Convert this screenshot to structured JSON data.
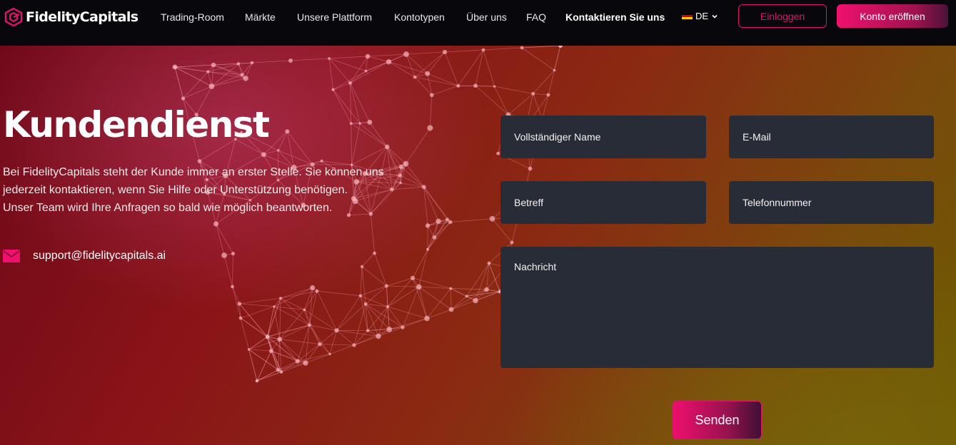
{
  "brand": {
    "name": "FidelityCapitals",
    "accent": "#e0146f"
  },
  "nav": {
    "links": [
      {
        "label": "Trading-Room"
      },
      {
        "label": "Märkte"
      },
      {
        "label": "Unsere Plattform"
      },
      {
        "label": "Kontotypen"
      },
      {
        "label": "Über uns"
      },
      {
        "label": "FAQ"
      },
      {
        "label": "Kontaktieren Sie uns",
        "active": true
      }
    ],
    "language": "DE",
    "login_label": "Einloggen",
    "open_account_label": "Konto eröffnen"
  },
  "hero": {
    "title": "Kundendienst",
    "intro_lines": [
      "Bei FidelityCapitals steht der Kunde immer an erster Stelle. Sie können uns",
      "jederzeit kontaktieren, wenn Sie Hilfe oder Unterstützung benötigen.",
      "Unser Team wird Ihre Anfragen so bald wie möglich beantworten."
    ],
    "email": "support@fidelitycapitals.ai"
  },
  "form": {
    "name_placeholder": "Vollständiger Name",
    "email_placeholder": "E-Mail",
    "subject_placeholder": "Betreff",
    "phone_placeholder": "Telefonnummer",
    "message_placeholder": "Nachricht",
    "submit_label": "Senden"
  }
}
